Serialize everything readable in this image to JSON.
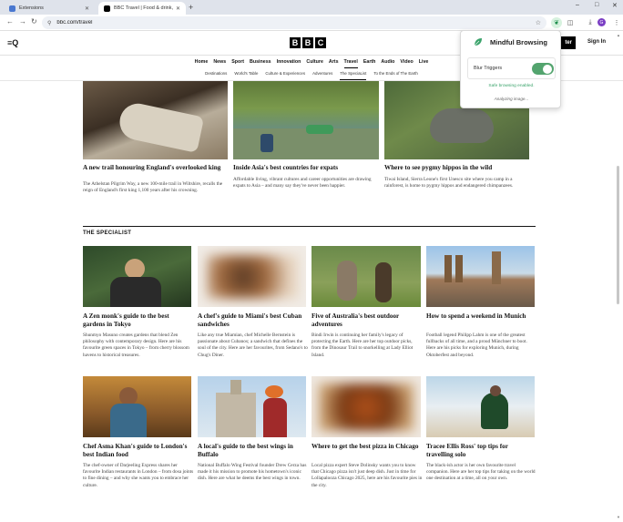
{
  "browser": {
    "tabs": [
      {
        "title": "Extensions",
        "active": false
      },
      {
        "title": "BBC Travel | Food & drink, Hist",
        "active": true
      }
    ],
    "new_tab": "+",
    "url": "bbc.com/travel",
    "window_controls": {
      "minimize": "–",
      "maximize": "□",
      "close": "✕"
    },
    "profile_initial": "G"
  },
  "bbc": {
    "logo_letters": [
      "B",
      "B",
      "C"
    ],
    "register_label": "ter",
    "signin_label": "Sign In",
    "nav": [
      "Home",
      "News",
      "Sport",
      "Business",
      "Innovation",
      "Culture",
      "Arts",
      "Travel",
      "Earth",
      "Audio",
      "Video",
      "Live"
    ],
    "nav_selected": "Travel",
    "subnav": [
      "Destinations",
      "World's Table",
      "Culture & Experiences",
      "Adventures",
      "The SpeciaList",
      "To the Ends of The Earth"
    ],
    "subnav_selected": "The SpeciaList"
  },
  "top_articles": [
    {
      "headline": "A new trail honouring England's overlooked king",
      "summary": "The Athelstan Pilgrim Way, a new 100-mile trail in Wiltshire, recalls the reign of England's first king 1,100 years after his crowning."
    },
    {
      "headline": "Inside Asia's best countries for expats",
      "summary": "Affordable living, vibrant cultures and career opportunities are drawing expats to Asia – and many say they've never been happier."
    },
    {
      "headline": "Where to see pygmy hippos in the wild",
      "summary": "Tiwai Island, Sierra Leone's first Unesco site where you camp in a rainforest, is home to pygmy hippos and endangered chimpanzees."
    }
  ],
  "section_title": "THE SPECIALIST",
  "specialist_articles": [
    {
      "headline": "A Zen monk's guide to the best gardens in Tokyo",
      "summary": "Shunmyo Masuno creates gardens that blend Zen philosophy with contemporary design. Here are his favourite green spaces in Tokyo – from cherry blossom havens to historical treasures."
    },
    {
      "headline": "A chef's guide to Miami's best Cuban sandwiches",
      "summary": "Like any true Miamian, chef Michelle Bernstein is passionate about Cubanos; a sandwich that defines the soul of the city. Here are her favourites, from Sedano's to Chug's Diner."
    },
    {
      "headline": "Five of Australia's best outdoor adventures",
      "summary": "Bindi Irwin is continuing her family's legacy of protecting the Earth. Here are her top outdoor picks, from the Dinosaur Trail to snorkelling at Lady Elliot Island."
    },
    {
      "headline": "How to spend a weekend in Munich",
      "summary": "Football legend Philipp Lahm is one of the greatest fullbacks of all time, and a proud Münchner to boot. Here are his picks for exploring Munich, during Oktoberfest and beyond."
    },
    {
      "headline": "Chef Asma Khan's guide to London's best Indian food",
      "summary": "The chef-owner of Darjeeling Express shares her favourite Indian restaurants in London – from dosa joints to fine dining – and why she wants you to embrace her culture."
    },
    {
      "headline": "A local's guide to the best wings in Buffalo",
      "summary": "National Buffalo Wing Festival founder Drew Cerza has made it his mission to promote his hometown's iconic dish. Here are what he deems the best wings in town."
    },
    {
      "headline": "Where to get the best pizza in Chicago",
      "summary": "Local pizza expert Steve Dolinsky wants you to know that Chicago pizza isn't just deep dish. Just in time for Lollapalooza Chicago 2025, here are his favourite pies in the city."
    },
    {
      "headline": "Tracee Ellis Ross' top tips for travelling solo",
      "summary": "The black-ish actor is her own favourite travel companion. Here are her top tips for taking on the world one destination at a time, all on your own."
    }
  ],
  "extension_popup": {
    "title": "Mindful Browsing",
    "toggle_label": "Blur Triggers",
    "toggle_on": true,
    "status": "Safe browsing enabled.",
    "analyzing": "Analyzing image..."
  },
  "colors": {
    "accent_green": "#53a46e",
    "status_green": "#3aa36b",
    "bbc_black": "#000000"
  }
}
